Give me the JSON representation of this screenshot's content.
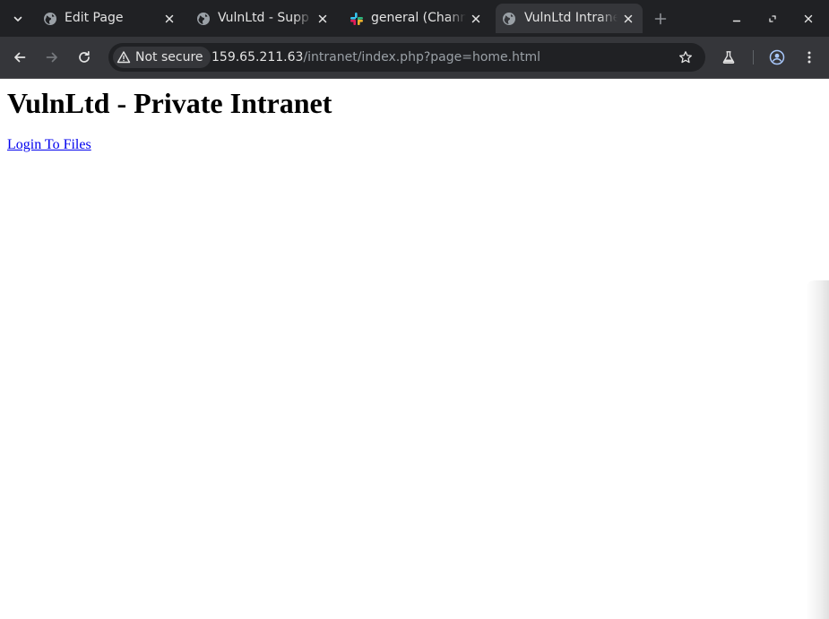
{
  "tabs": [
    {
      "title": "Edit Page",
      "favicon": "globe-icon",
      "active": false
    },
    {
      "title": "VulnLtd - Supp",
      "favicon": "globe-icon",
      "active": false
    },
    {
      "title": "general (Chann",
      "favicon": "slack-icon",
      "active": false
    },
    {
      "title": "VulnLtd Intrane",
      "favicon": "globe-icon",
      "active": true
    }
  ],
  "omnibox": {
    "security_label": "Not secure",
    "url_host": "159.65.211.63",
    "url_path": "/intranet/index.php?page=home.html"
  },
  "page": {
    "heading": "VulnLtd - Private Intranet",
    "link": "Login To Files"
  },
  "colors": {
    "chrome_dark": "#202124",
    "chrome_toolbar": "#35363a",
    "link": "#0000ee"
  }
}
